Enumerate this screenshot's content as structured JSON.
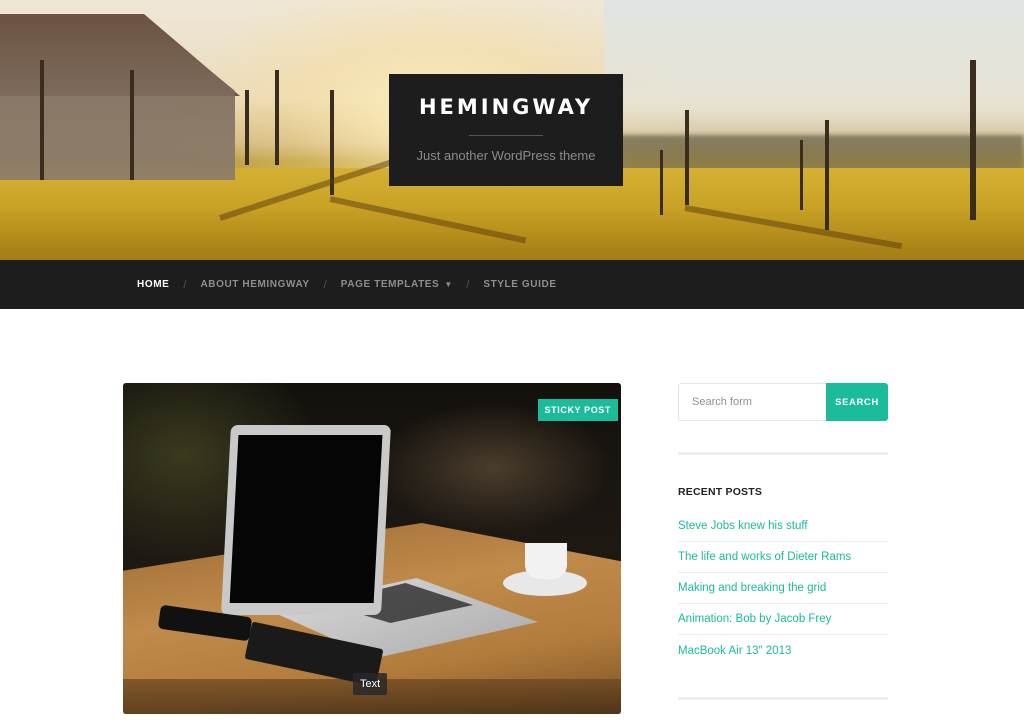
{
  "site": {
    "title": "HEMINGWAY",
    "tagline": "Just another WordPress theme"
  },
  "nav": {
    "items": [
      {
        "label": "HOME",
        "active": true
      },
      {
        "label": "ABOUT HEMINGWAY",
        "active": false
      },
      {
        "label": "PAGE TEMPLATES",
        "active": false,
        "has_dropdown": true
      },
      {
        "label": "STYLE GUIDE",
        "active": false
      }
    ],
    "separator": "/",
    "dropdown_icon": "caret-down-icon"
  },
  "post": {
    "badge": "STICKY POST",
    "media_caption": "Text"
  },
  "sidebar": {
    "search": {
      "placeholder": "Search form",
      "value": "",
      "button_label": "SEARCH"
    },
    "recent_posts": {
      "title": "RECENT POSTS",
      "items": [
        "Steve Jobs knew his stuff",
        "The life and works of Dieter Rams",
        "Making and breaking the grid",
        "Animation: Bob by Jacob Frey",
        "MacBook Air 13″ 2013"
      ]
    }
  },
  "colors": {
    "accent": "#1abc9c",
    "header_dark": "#1d1d1d",
    "nav_text": "#8e8e8e"
  }
}
